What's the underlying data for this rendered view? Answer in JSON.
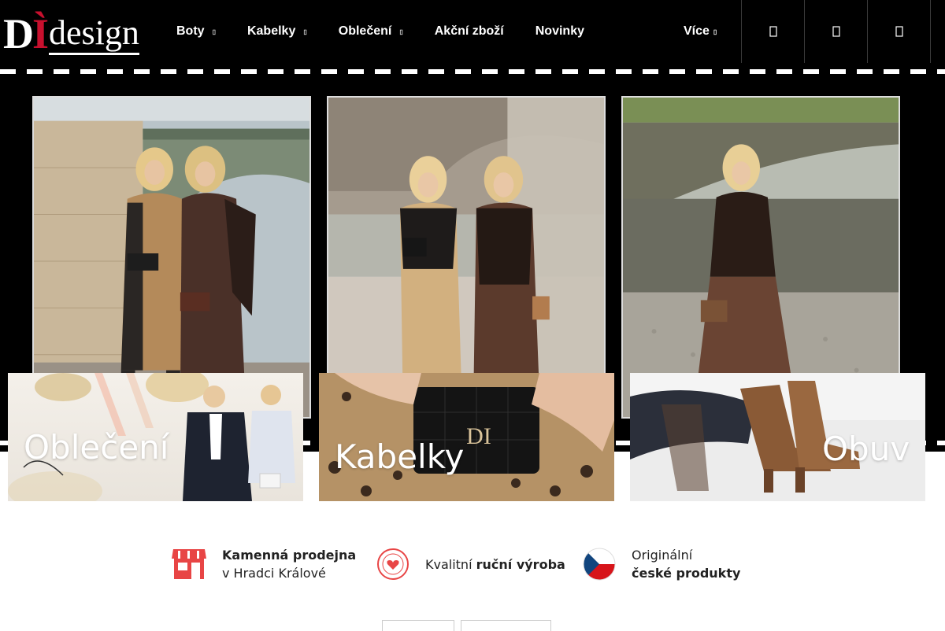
{
  "logo": {
    "letters": "DÌ",
    "word": "design"
  },
  "nav": {
    "items": [
      {
        "label": "Boty",
        "has_dropdown": true
      },
      {
        "label": "Kabelky",
        "has_dropdown": true
      },
      {
        "label": "Oblečení",
        "has_dropdown": true
      },
      {
        "label": "Akční zboží",
        "has_dropdown": false
      },
      {
        "label": "Novinky",
        "has_dropdown": false
      }
    ],
    "more": "Více"
  },
  "header_icons": [
    "search-icon",
    "user-icon",
    "cart-icon"
  ],
  "hero": {
    "photos": [
      "two-women-leopard-dress-bridge",
      "two-women-leopard-river",
      "woman-leopard-dress-bridge"
    ]
  },
  "categories": [
    {
      "label": "Oblečení"
    },
    {
      "label": "Kabelky"
    },
    {
      "label": "Obuv"
    }
  ],
  "features": [
    {
      "icon": "storefront-icon",
      "line1": "Kamenná prodejna",
      "line2": "v Hradci Králové"
    },
    {
      "icon": "handmade-stamp-icon",
      "plain": "Kvalitní ",
      "bold": "ruční výroba"
    },
    {
      "icon": "czech-flag-icon",
      "line1": "Originální",
      "line2": "české produkty"
    }
  ],
  "colors": {
    "header_bg": "#000000",
    "accent_red": "#e84545",
    "logo_red": "#c8102e"
  }
}
